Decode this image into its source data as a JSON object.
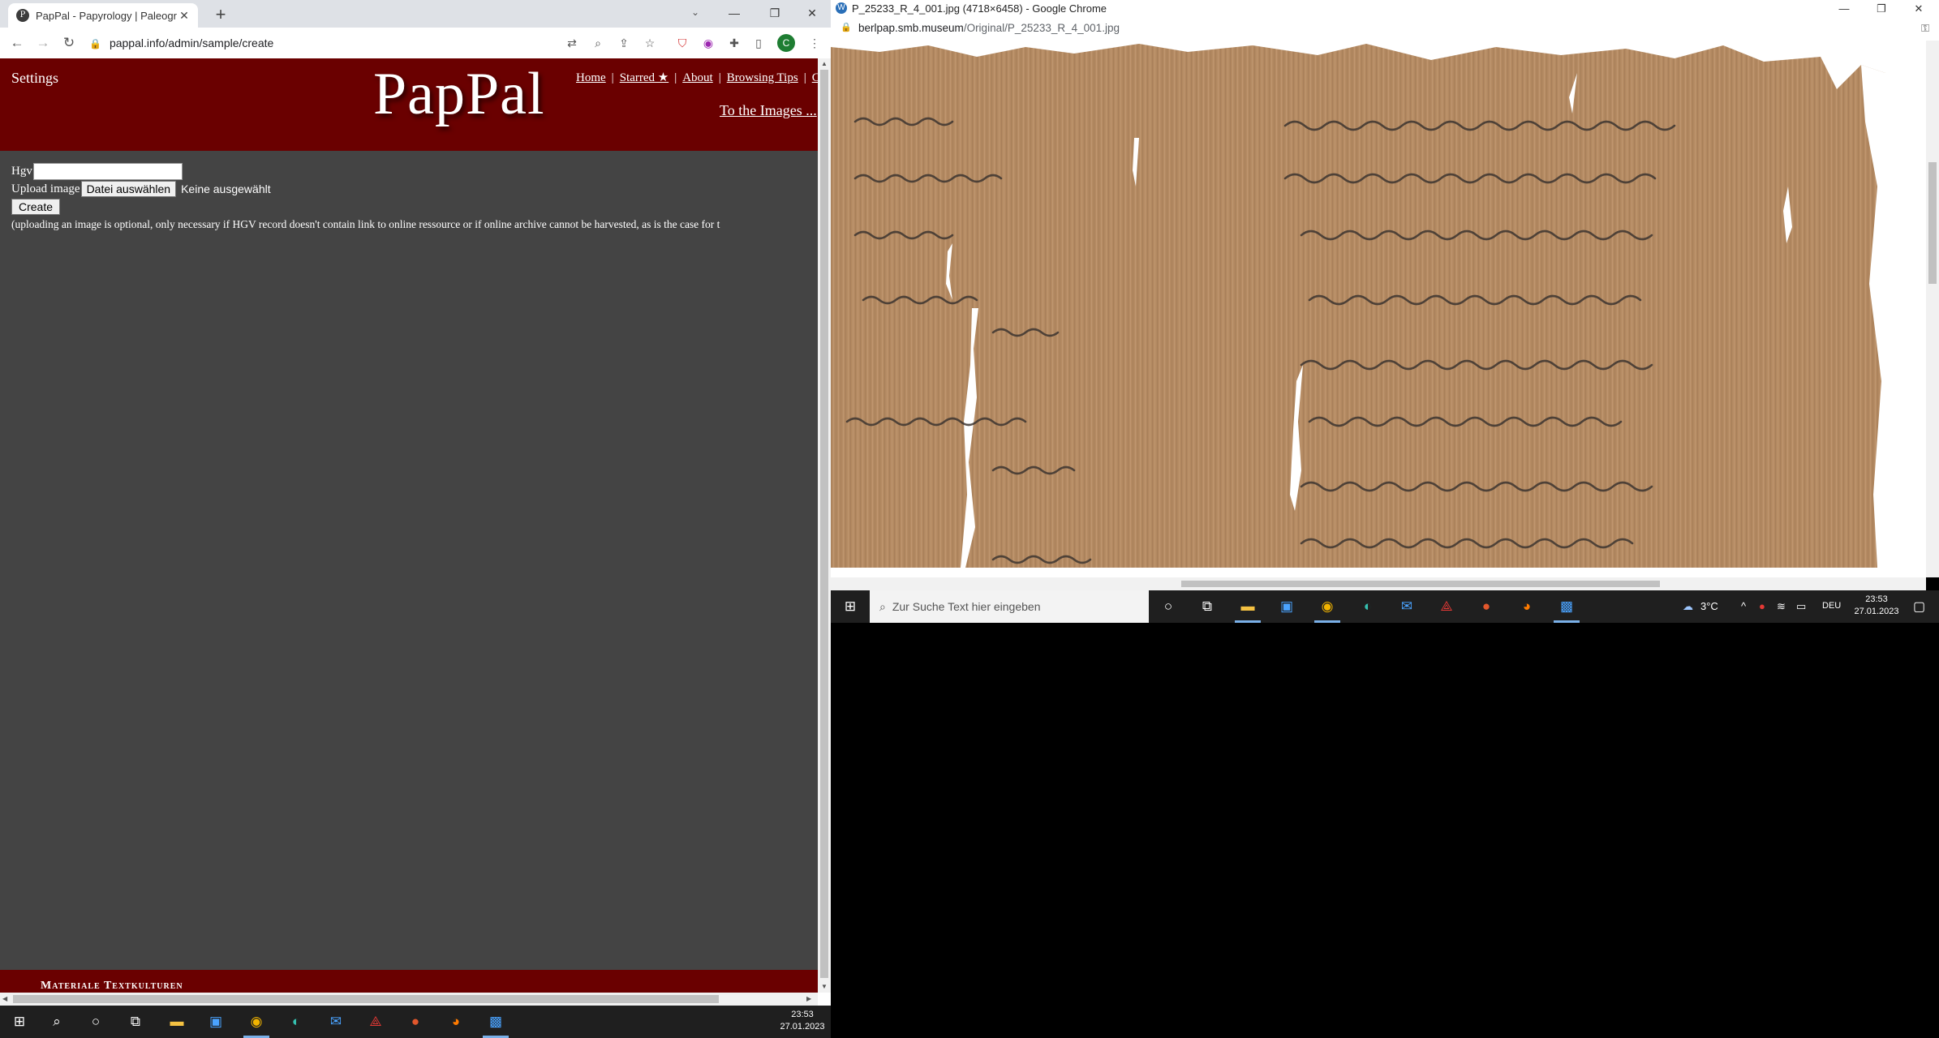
{
  "left_window": {
    "tab_title": "PapPal - Papyrology | Paleograph",
    "tab_favicon": "P",
    "new_tab": "+",
    "url": "pappal.info/admin/sample/create",
    "profile_initial": "C"
  },
  "pappal": {
    "settings_label": "Settings",
    "logo": "PapPal",
    "nav": [
      "Home",
      "Starred ★",
      "About",
      "Browsing Tips",
      "C"
    ],
    "to_images": "To the Images ...",
    "hgv_label": "Hgv",
    "hgv_value": "",
    "upload_label": "Upload image",
    "file_button": "Datei auswählen",
    "file_status": "Keine ausgewählt",
    "create_button": "Create",
    "note": "(uploading an image is optional, only necessary if HGV record doesn't contain link to online ressource or if online archive cannot be harvested, as is the case for t",
    "footer_text": "Materiale Textkulturen"
  },
  "right_window": {
    "title": "P_25233_R_4_001.jpg (4718×6458) - Google Chrome",
    "url_host": "berlpap.smb.museum",
    "url_path": "/Original/P_25233_R_4_001.jpg"
  },
  "taskbar_left": {
    "time": "23:53",
    "date": "27.01.2023"
  },
  "taskbar_right": {
    "search_placeholder": "Zur Suche Text hier eingeben",
    "temperature": "3°C",
    "language": "DEU",
    "time": "23:53",
    "date": "27.01.2023"
  },
  "colors": {
    "pappal_red": "#6a0000",
    "pappal_gray": "#444444",
    "papyrus": "#b08560"
  }
}
